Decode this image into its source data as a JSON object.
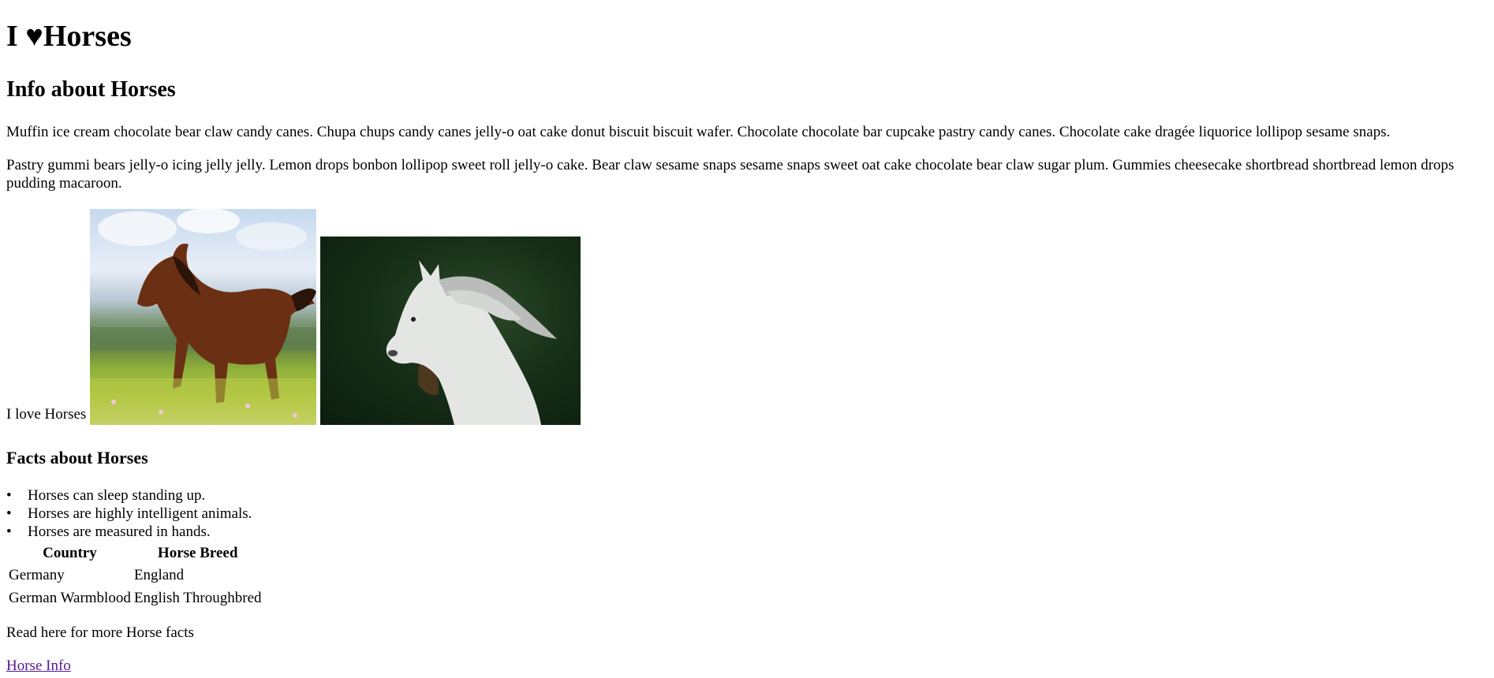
{
  "header": {
    "title": "I ♥Horses",
    "subtitle": "Info about Horses"
  },
  "paragraphs": [
    "Muffin ice cream chocolate bear claw candy canes. Chupa chups candy canes jelly-o oat cake donut biscuit biscuit wafer. Chocolate chocolate bar cupcake pastry candy canes. Chocolate cake dragée liquorice lollipop sesame snaps.",
    "Pastry gummi bears jelly-o icing jelly jelly. Lemon drops bonbon lollipop sweet roll jelly-o cake. Bear claw sesame snaps sesame snaps sweet oat cake chocolate bear claw sugar plum. Gummies cheesecake shortbread shortbread lemon drops pudding macaroon."
  ],
  "gallery": {
    "caption": "I love Horses"
  },
  "facts": {
    "heading": "Facts about Horses",
    "items": [
      "Horses can sleep standing up.",
      "Horses are highly intelligent animals.",
      "Horses are measured in hands."
    ]
  },
  "table": {
    "headers": [
      "Country",
      "Horse Breed"
    ],
    "rows": [
      [
        "Germany",
        "England"
      ],
      [
        "German Warmblood",
        "English Throughbred"
      ]
    ]
  },
  "footer": {
    "more_text": "Read here for more Horse facts",
    "link_label": "Horse Info"
  },
  "colors": {
    "link_visited": "#551a8b",
    "text": "#000000",
    "background": "#ffffff"
  }
}
